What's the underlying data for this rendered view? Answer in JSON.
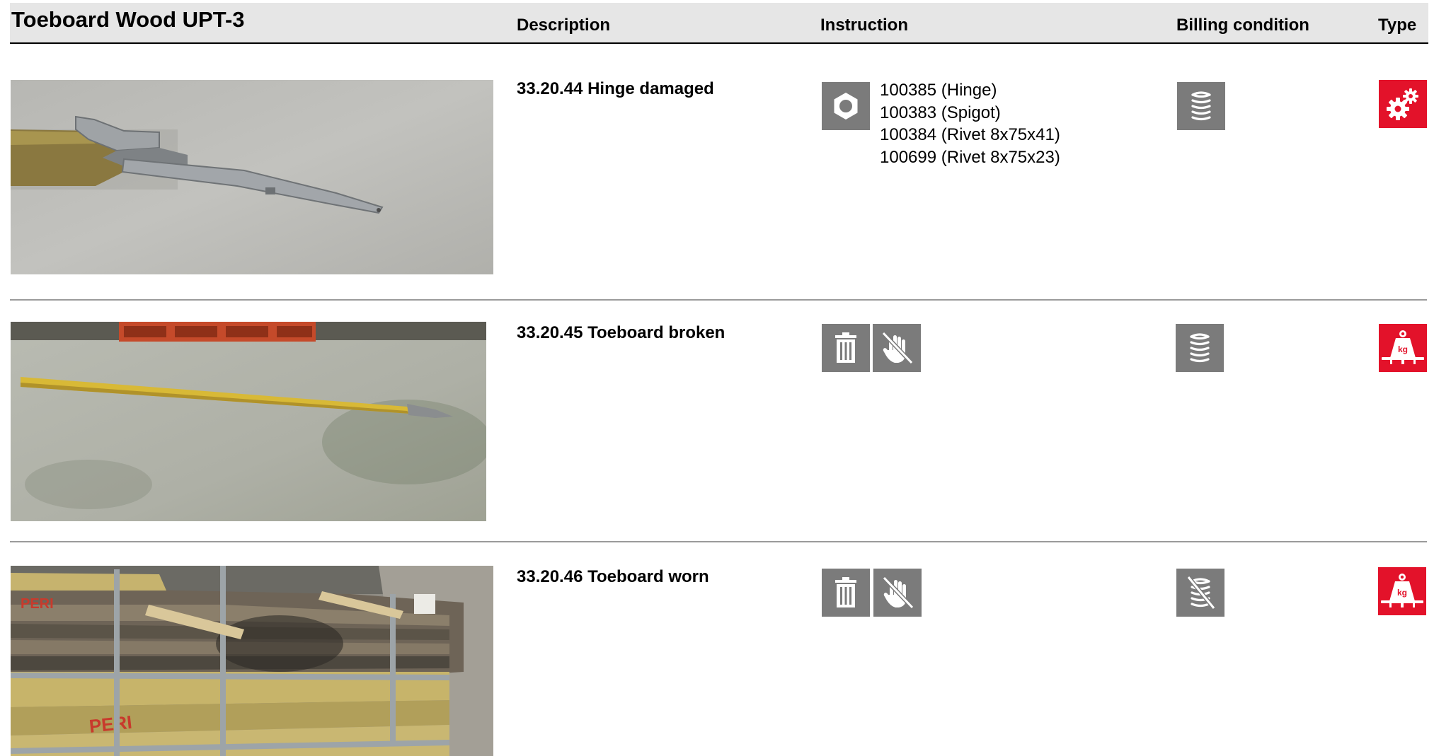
{
  "header": {
    "title": "Toeboard Wood UPT-3",
    "col_description": "Description",
    "col_instruction": "Instruction",
    "col_billing": "Billing condition",
    "col_type": "Type"
  },
  "rows": [
    {
      "description": "33.20.44 Hinge damaged",
      "instruction_icons": [
        "hex-nut-icon"
      ],
      "parts": [
        "100385 (Hinge)",
        "100383 (Spigot)",
        "100384 (Rivet 8x75x41)",
        "100699 (Rivet 8x75x23)"
      ],
      "billing_icon": "coil-stack-icon",
      "type_icon": "gears-icon"
    },
    {
      "description": "33.20.45 Toeboard broken",
      "instruction_icons": [
        "trash-icon",
        "no-hand-icon"
      ],
      "parts": [],
      "billing_icon": "coil-stack-icon",
      "type_icon": "weight-kg-icon"
    },
    {
      "description": "33.20.46 Toeboard worn",
      "instruction_icons": [
        "trash-icon",
        "no-hand-icon"
      ],
      "parts": [],
      "billing_icon": "coil-stack-crossed-icon",
      "type_icon": "weight-kg-icon"
    }
  ],
  "photo_labels": {
    "crate_brand": "PERI"
  },
  "colors": {
    "header_bg": "#e6e6e6",
    "icon_gray": "#7b7b7b",
    "type_red": "#e3122a",
    "divider": "#9b9b9b"
  }
}
